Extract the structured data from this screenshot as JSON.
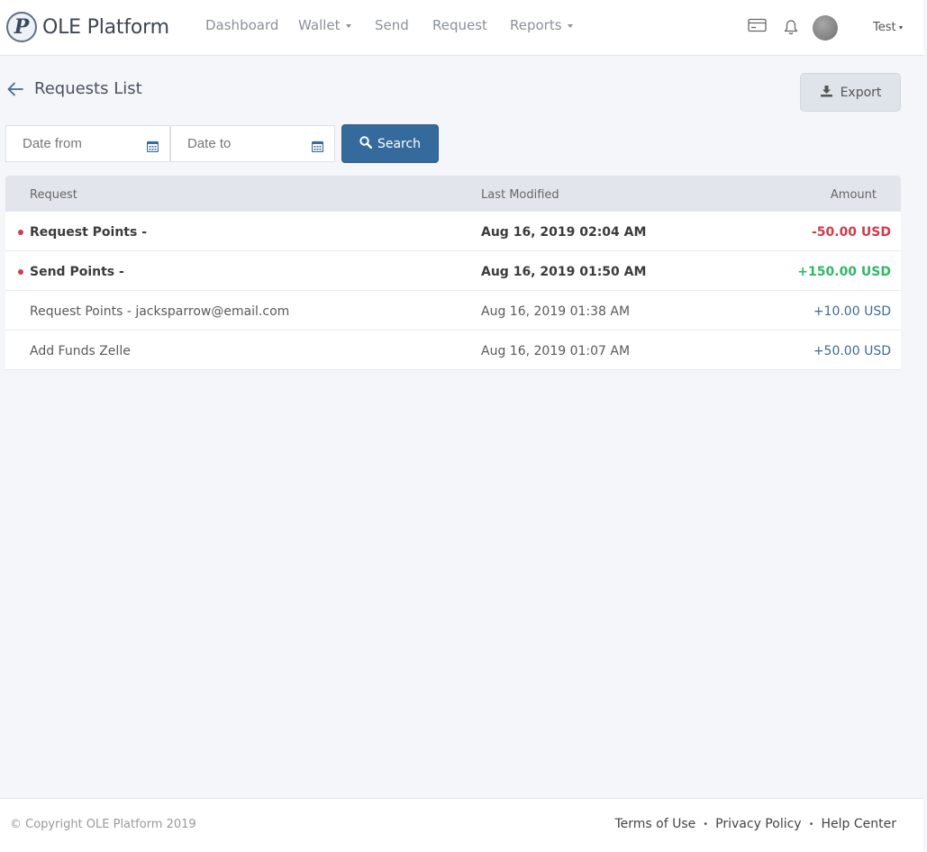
{
  "brand": {
    "logo_letter": "P",
    "name": "OLE Platform"
  },
  "nav": {
    "dashboard": "Dashboard",
    "wallet": "Wallet",
    "send": "Send",
    "request": "Request",
    "reports": "Reports"
  },
  "header_icons": {
    "card": "credit-card-icon",
    "bell": "bell-icon"
  },
  "user": {
    "name": "Test"
  },
  "page": {
    "title": "Requests List",
    "export_label": "Export"
  },
  "filters": {
    "date_from_placeholder": "Date from",
    "date_to_placeholder": "Date to",
    "search_label": "Search"
  },
  "table": {
    "headers": {
      "request": "Request",
      "last_modified": "Last Modified",
      "amount": "Amount"
    },
    "rows": [
      {
        "request": "Request Points -",
        "modified": "Aug 16, 2019 02:04 AM",
        "amount": "-50.00 USD",
        "unread": true
      },
      {
        "request": "Send Points -",
        "modified": "Aug 16, 2019 01:50 AM",
        "amount": "+150.00 USD",
        "unread": true
      },
      {
        "request": "Request Points - jacksparrow@email.com",
        "modified": "Aug 16, 2019 01:38 AM",
        "amount": "+10.00 USD",
        "unread": false
      },
      {
        "request": "Add Funds Zelle",
        "modified": "Aug 16, 2019 01:07 AM",
        "amount": "+50.00 USD",
        "unread": false
      }
    ]
  },
  "footer": {
    "copyright": "© Copyright OLE Platform 2019",
    "terms": "Terms of Use",
    "privacy": "Privacy Policy",
    "help": "Help Center",
    "separator": "•"
  },
  "colors": {
    "primary": "#346a9c",
    "negative": "#d23a4a",
    "positive": "#2fb867",
    "positive_muted": "#3e6b96"
  }
}
